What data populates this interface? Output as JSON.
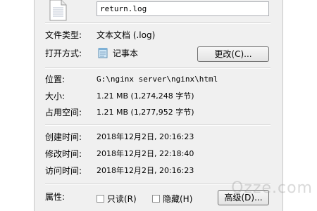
{
  "file": {
    "name": "return.log",
    "icon": "text-file-icon"
  },
  "general": {
    "type_label": "文件类型:",
    "type_value": "文本文档 (.log)",
    "opens_label": "打开方式:",
    "opens_value": "记事本",
    "opens_icon": "notepad-icon",
    "change_button": "更改(C)..."
  },
  "location": {
    "location_label": "位置:",
    "location_value": "G:\\nginx server\\nginx\\html",
    "size_label": "大小:",
    "size_value": "1.21 MB (1,274,248 字节)",
    "disk_label": "占用空间:",
    "disk_value": "1.21 MB (1,277,952 字节)"
  },
  "times": {
    "created_label": "创建时间:",
    "created_value": "2018年12月2日, 20:16:23",
    "modified_label": "修改时间:",
    "modified_value": "2018年12月2日, 22:18:40",
    "accessed_label": "访问时间:",
    "accessed_value": "2018年12月2日, 20:16:23"
  },
  "attributes": {
    "label": "属性:",
    "readonly_label": "只读(R)",
    "readonly_checked": false,
    "hidden_label": "隐藏(H)",
    "hidden_checked": false,
    "advanced_button": "高级(D)..."
  },
  "watermark": "Ozze.com"
}
